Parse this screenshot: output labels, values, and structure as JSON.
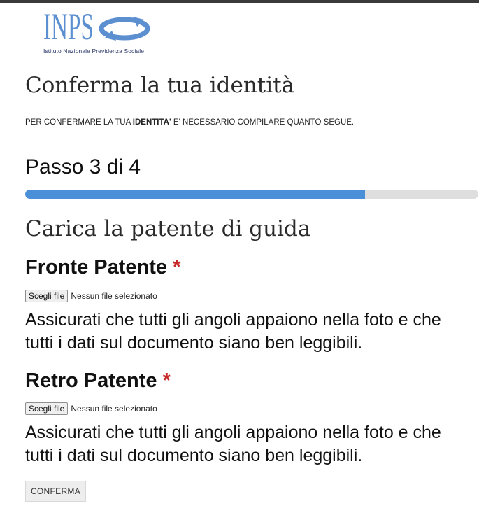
{
  "logo": {
    "wordmark": "INPS",
    "subtitle": "Istituto Nazionale Previdenza Sociale"
  },
  "page": {
    "title": "Conferma la tua identità",
    "notice_before": "PER CONFERMARE LA TUA ",
    "notice_bold": "IDENTITA'",
    "notice_after": " E' NECESSARIO COMPILARE QUANTO SEGUE."
  },
  "progress": {
    "label": "Passo 3 di 4",
    "fraction": 0.75
  },
  "section": {
    "title": "Carica la patente di guida"
  },
  "fields": [
    {
      "label": "Fronte Patente",
      "required_mark": "*",
      "button_label": "Scegli file",
      "status": "Nessun file selezionato",
      "hint": "Assicurati che tutti gli angoli appaiono nella foto e che tutti i dati sul documento siano ben leggibili."
    },
    {
      "label": "Retro Patente",
      "required_mark": "*",
      "button_label": "Scegli file",
      "status": "Nessun file selezionato",
      "hint": "Assicurati che tutti gli angoli appaiono nella foto e che tutti i dati sul documento siano ben leggibili."
    }
  ],
  "submit_label": "CONFERMA",
  "colors": {
    "brand_blue": "#4a7fc1",
    "progress_fill": "#4a90d9",
    "progress_track": "#dedede",
    "required": "#c62828"
  }
}
